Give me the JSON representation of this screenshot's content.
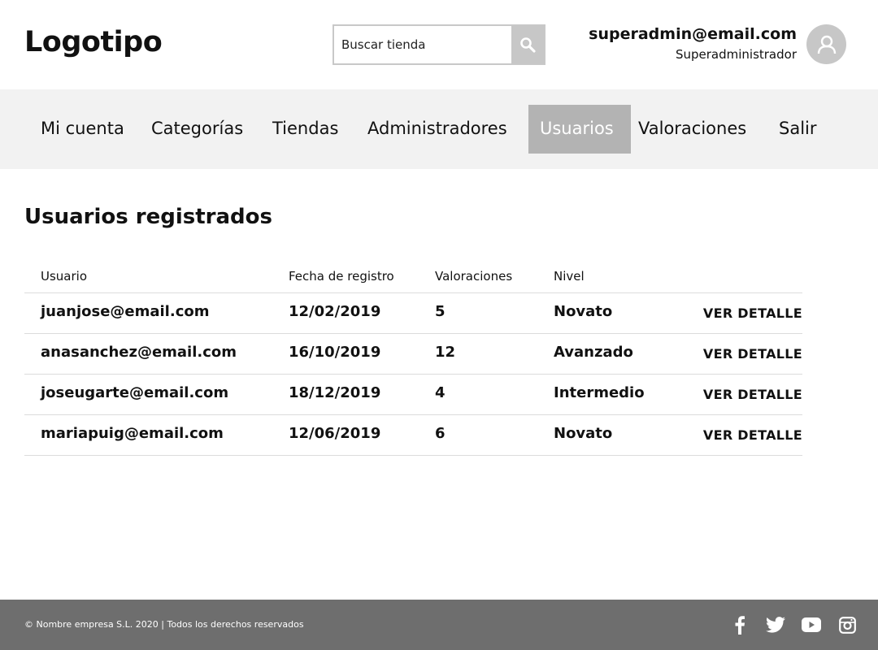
{
  "header": {
    "logo": "Logotipo",
    "search": {
      "placeholder": "Buscar tienda",
      "value": ""
    },
    "user": {
      "email": "superadmin@email.com",
      "role": "Superadministrador"
    }
  },
  "nav": {
    "items": [
      {
        "label": "Mi cuenta"
      },
      {
        "label": "Categorías"
      },
      {
        "label": "Tiendas"
      },
      {
        "label": "Administradores"
      },
      {
        "label": "Usuarios",
        "active": true
      },
      {
        "label": "Valoraciones"
      },
      {
        "label": "Salir"
      }
    ]
  },
  "main": {
    "title": "Usuarios registrados",
    "table": {
      "headers": [
        "Usuario",
        "Fecha de registro",
        "Valoraciones",
        "Nivel"
      ],
      "rows": [
        {
          "user": "juanjose@email.com",
          "date": "12/02/2019",
          "ratings": "5",
          "level": "Novato",
          "action": "VER DETALLE"
        },
        {
          "user": "anasanchez@email.com",
          "date": "16/10/2019",
          "ratings": "12",
          "level": "Avanzado",
          "action": "VER DETALLE"
        },
        {
          "user": "joseugarte@email.com",
          "date": "18/12/2019",
          "ratings": "4",
          "level": "Intermedio",
          "action": "VER DETALLE"
        },
        {
          "user": "mariapuig@email.com",
          "date": "12/06/2019",
          "ratings": "6",
          "level": "Novato",
          "action": "VER DETALLE"
        }
      ]
    }
  },
  "footer": {
    "copyright": "© Nombre empresa S.L. 2020 | Todos los derechos reservados",
    "social": [
      "facebook-icon",
      "twitter-icon",
      "youtube-icon",
      "instagram-icon"
    ]
  },
  "colors": {
    "nav_bg": "#f2f2f2",
    "nav_active": "#b3b3b3",
    "footer_bg": "#6e6e6e",
    "icon_gray": "#c7c7c7"
  }
}
